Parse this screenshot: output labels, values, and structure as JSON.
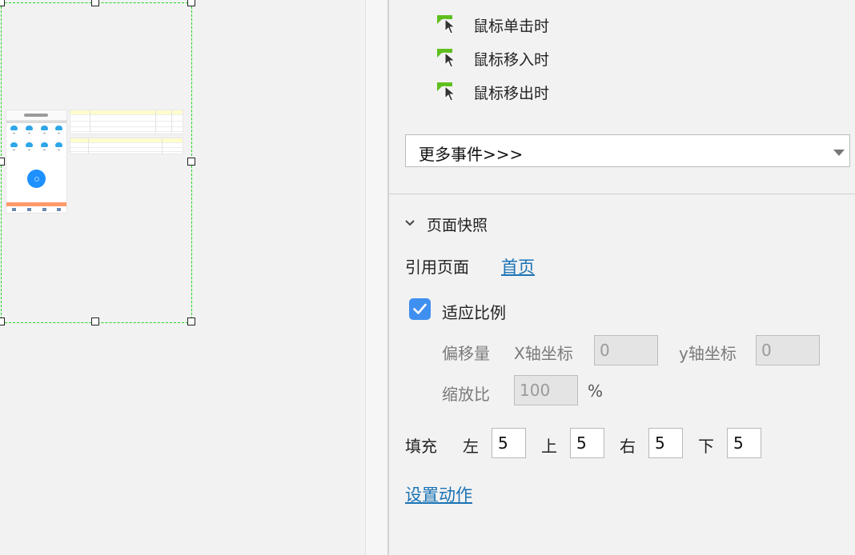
{
  "events": [
    {
      "label": "鼠标单击时"
    },
    {
      "label": "鼠标移入时"
    },
    {
      "label": "鼠标移出时"
    }
  ],
  "more_events": {
    "label": "更多事件>>>"
  },
  "snapshot": {
    "title": "页面快照",
    "ref_page_label": "引用页面",
    "ref_page_link": "首页",
    "fit_label": "适应比例",
    "fit_checked": true,
    "offset_label": "偏移量",
    "x_label": "X轴坐标",
    "x_value": "0",
    "y_label": "y轴坐标",
    "y_value": "0",
    "scale_label": "缩放比",
    "scale_value": "100",
    "scale_unit": "%",
    "padding_label": "填充",
    "left_label": "左",
    "left_value": "5",
    "top_label": "上",
    "top_value": "5",
    "right_label": "右",
    "right_value": "5",
    "bottom_label": "下",
    "bottom_value": "5",
    "set_action": "设置动作"
  },
  "colors": {
    "accent_blue": "#3f8ff0",
    "link_blue": "#1a73b5",
    "selection_green": "#1ed41e",
    "event_icon_green": "#5fbf1e"
  }
}
